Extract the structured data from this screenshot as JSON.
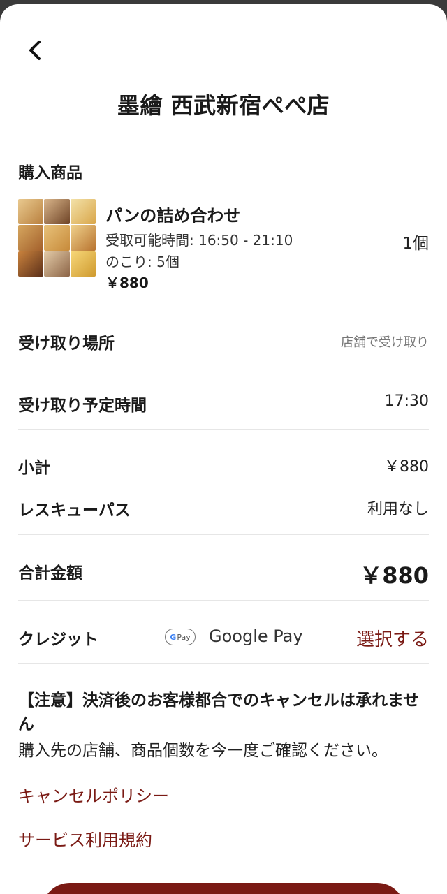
{
  "header": {
    "title": "墨繪 西武新宿ぺぺ店"
  },
  "purchase": {
    "section_label": "購入商品",
    "product": {
      "name": "パンの詰め合わせ",
      "pickup_window": "受取可能時間: 16:50 - 21:10",
      "remaining": "のこり: 5個",
      "price": "￥880",
      "quantity": "1個"
    }
  },
  "rows": {
    "pickup_place": {
      "label": "受け取り場所",
      "value": "店舗で受け取り"
    },
    "pickup_time": {
      "label": "受け取り予定時間",
      "value": "17:30"
    },
    "subtotal": {
      "label": "小計",
      "value": "￥880"
    },
    "rescue_pass": {
      "label": "レスキューパス",
      "value": "利用なし"
    },
    "total": {
      "label": "合計金額",
      "value": "￥880"
    }
  },
  "payment": {
    "label": "クレジット",
    "badge": "G Pay",
    "method": "Google Pay",
    "select_label": "選択する"
  },
  "notice": {
    "title": "【注意】決済後のお客様都合でのキャンセルは承れません",
    "body": "購入先の店舗、商品個数を今一度ご確認ください。"
  },
  "links": {
    "cancel_policy": "キャンセルポリシー",
    "terms": "サービス利用規約"
  },
  "colors": {
    "accent": "#7a1a14",
    "divider": "#e6e6e6"
  },
  "icons": {
    "back": "chevron-left-icon",
    "product_image": "bread-assortment-image"
  }
}
